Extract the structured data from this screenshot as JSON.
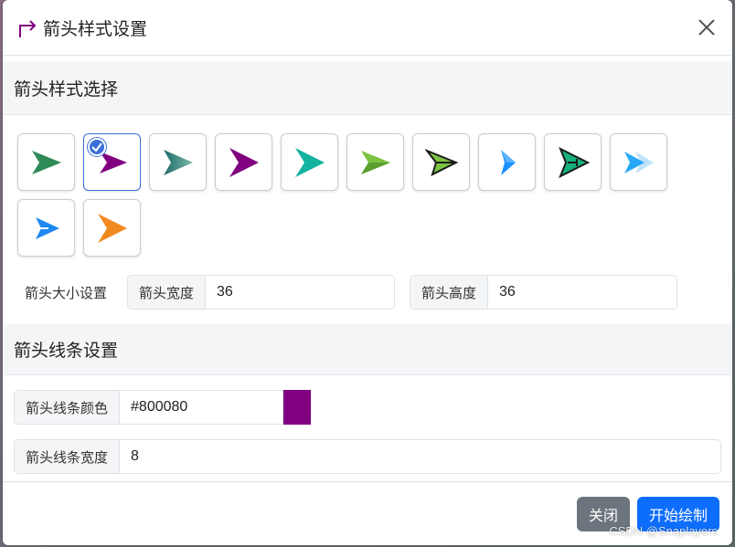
{
  "dialog": {
    "title": "箭头样式设置",
    "close_label": "×"
  },
  "style_section": {
    "heading": "箭头样式选择",
    "arrows": [
      {
        "icon": "arrow-style-1-icon",
        "color": "#2e8b57",
        "selected": false
      },
      {
        "icon": "arrow-style-2-icon",
        "color": "#800080",
        "selected": true
      },
      {
        "icon": "arrow-style-3-icon",
        "color": "#2a7f7f",
        "selected": false
      },
      {
        "icon": "arrow-style-4-icon",
        "color": "#800080",
        "selected": false
      },
      {
        "icon": "arrow-style-5-icon",
        "color": "#14b3a0",
        "selected": false
      },
      {
        "icon": "arrow-style-6-icon",
        "color": "#7cc242",
        "selected": false
      },
      {
        "icon": "arrow-style-7-icon",
        "color": "#5aa832",
        "selected": false
      },
      {
        "icon": "arrow-style-8-icon",
        "color": "#1e90ff",
        "selected": false
      },
      {
        "icon": "arrow-style-9-icon",
        "color": "#16b07a",
        "selected": false
      },
      {
        "icon": "arrow-style-10-icon",
        "color": "#29a9f5",
        "selected": false
      },
      {
        "icon": "arrow-style-11-icon",
        "color": "#1e88f0",
        "selected": false
      },
      {
        "icon": "arrow-style-12-icon",
        "color": "#f28a22",
        "selected": false
      }
    ]
  },
  "size": {
    "label": "箭头大小设置",
    "width_label": "箭头宽度",
    "width_value": "36",
    "height_label": "箭头高度",
    "height_value": "36"
  },
  "line_section": {
    "heading": "箭头线条设置",
    "color_label": "箭头线条颜色",
    "color_value": "#800080",
    "width_label": "箭头线条宽度",
    "width_value": "8"
  },
  "footer": {
    "close_button": "关闭",
    "start_button": "开始绘制"
  },
  "watermark": "CSDN @Snaplayers",
  "colors": {
    "primary": "#0d6efd",
    "secondary": "#6c757d",
    "swatch": "#800080"
  }
}
